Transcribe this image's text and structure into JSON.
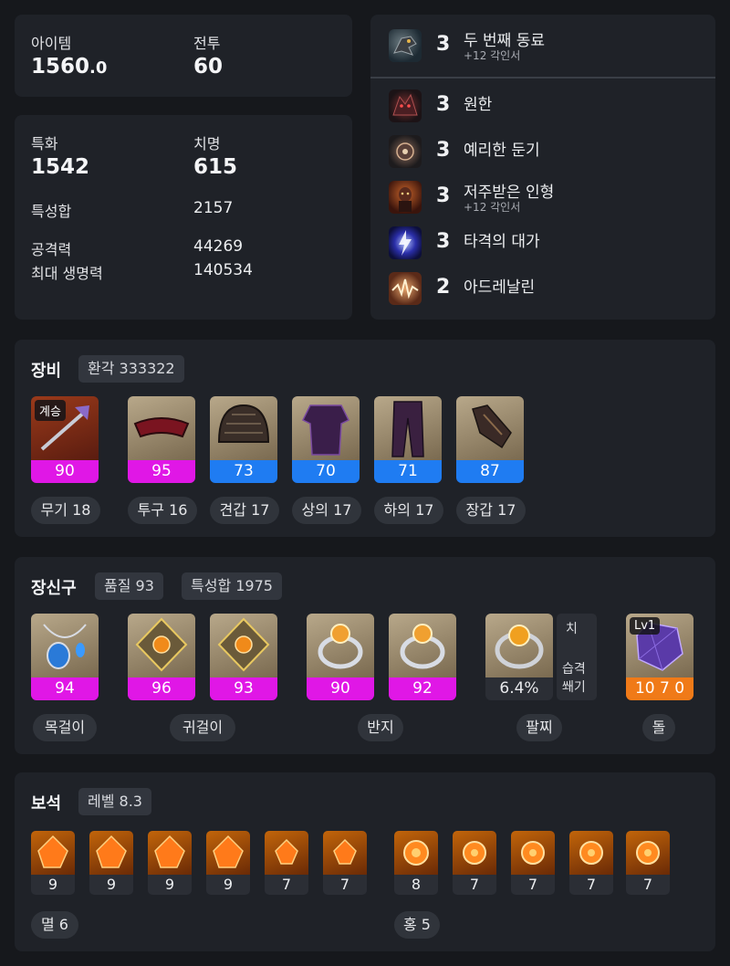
{
  "summary": {
    "item_label": "아이템",
    "item_value_int": "1560",
    "item_value_dec": ".0",
    "combat_label": "전투",
    "combat_value": "60"
  },
  "stats": {
    "spec_label": "특화",
    "spec_value": "1542",
    "crit_label": "치명",
    "crit_value": "615",
    "total_label": "특성합",
    "total_value": "2157",
    "atk_label": "공격력",
    "atk_value": "44269",
    "hp_label": "최대 생명력",
    "hp_value": "140534"
  },
  "engravings": [
    {
      "level": "3",
      "name": "두 번째 동료",
      "sub": "+12 각인서",
      "icon": "dragon-icon"
    },
    {
      "level": "3",
      "name": "원한",
      "sub": "",
      "icon": "beast-icon"
    },
    {
      "level": "3",
      "name": "예리한 둔기",
      "sub": "",
      "icon": "mace-icon"
    },
    {
      "level": "3",
      "name": "저주받은 인형",
      "sub": "+12 각인서",
      "icon": "doll-icon"
    },
    {
      "level": "3",
      "name": "타격의 대가",
      "sub": "",
      "icon": "lightning-icon"
    },
    {
      "level": "2",
      "name": "아드레날린",
      "sub": "",
      "icon": "adrenaline-icon"
    }
  ],
  "equipment": {
    "title": "장비",
    "transcend_chip": "환각 333322",
    "items": [
      {
        "tag": "계승",
        "quality": "90",
        "label": "무기 18",
        "bar": "magenta",
        "icon": "weapon-icon"
      },
      {
        "tag": "",
        "quality": "95",
        "label": "투구 16",
        "bar": "magenta",
        "icon": "helmet-icon"
      },
      {
        "tag": "",
        "quality": "73",
        "label": "견갑 17",
        "bar": "blue",
        "icon": "shoulder-icon"
      },
      {
        "tag": "",
        "quality": "70",
        "label": "상의 17",
        "bar": "blue",
        "icon": "chest-icon"
      },
      {
        "tag": "",
        "quality": "71",
        "label": "하의 17",
        "bar": "blue",
        "icon": "pants-icon"
      },
      {
        "tag": "",
        "quality": "87",
        "label": "장갑 17",
        "bar": "blue",
        "icon": "gloves-icon"
      }
    ]
  },
  "accessories": {
    "title": "장신구",
    "quality_chip": "품질 93",
    "total_chip": "특성합 1975",
    "items": [
      {
        "quality": "94",
        "bar": "magenta",
        "icon": "necklace-icon"
      },
      {
        "quality": "96",
        "bar": "magenta",
        "icon": "earring-icon"
      },
      {
        "quality": "93",
        "bar": "magenta",
        "icon": "earring-icon"
      },
      {
        "quality": "90",
        "bar": "magenta",
        "icon": "ring-icon"
      },
      {
        "quality": "92",
        "bar": "magenta",
        "icon": "ring-icon"
      }
    ],
    "bracelet": {
      "value": "6.4%",
      "side_top": "치",
      "side_mid": "습격",
      "side_bot": "쐐기",
      "icon": "bracelet-icon"
    },
    "stone": {
      "tag": "Lv1",
      "value": "10 7 0",
      "icon": "stone-icon"
    },
    "labels": {
      "necklace": "목걸이",
      "earring": "귀걸이",
      "ring": "반지",
      "bracelet": "팔찌",
      "stone": "돌"
    }
  },
  "gems": {
    "title": "보석",
    "level_chip": "레벨 8.3",
    "annihilation": [
      "9",
      "9",
      "9",
      "9",
      "7",
      "7"
    ],
    "crimson": [
      "8",
      "7",
      "7",
      "7",
      "7"
    ],
    "annihilation_label": "멸 6",
    "crimson_label": "홍 5"
  },
  "colors": {
    "magenta": "#e017e6",
    "blue": "#1f7cf2",
    "orange": "#f07a18",
    "panel": "#1f2228"
  }
}
